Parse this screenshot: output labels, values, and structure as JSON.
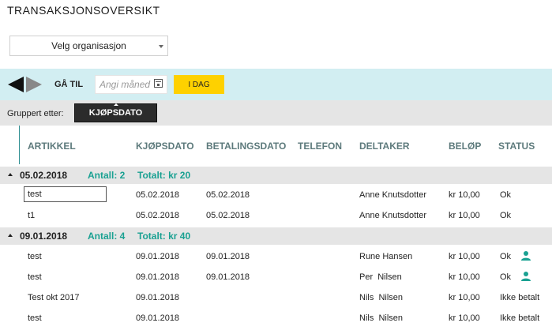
{
  "page": {
    "title": "TRANSAKSJONSOVERSIKT"
  },
  "org_select": {
    "value": "Velg organisasjon"
  },
  "nav": {
    "goto_label": "GÅ TIL",
    "month_placeholder": "Angi måned",
    "today_label": "I DAG"
  },
  "grouping": {
    "label": "Gruppert etter:",
    "chip_label": "KJØPSDATO"
  },
  "columns": {
    "artikkel": "ARTIKKEL",
    "kjopsdato": "KJØPSDATO",
    "betalingsdato": "BETALINGSDATO",
    "telefon": "TELEFON",
    "deltaker": "DELTAKER",
    "belop": "BELØP",
    "status": "STATUS"
  },
  "groups": [
    {
      "date": "05.02.2018",
      "count": "Antall: 2",
      "total": "Totalt: kr 20",
      "rows": [
        {
          "artikkel": "test",
          "kjopsdato": "05.02.2018",
          "betalingsdato": "05.02.2018",
          "telefon": "",
          "deltaker": "Anne Knutsdotter",
          "belop": "kr 10,00",
          "status": "Ok"
        },
        {
          "artikkel": "t1",
          "kjopsdato": "05.02.2018",
          "betalingsdato": "05.02.2018",
          "telefon": "",
          "deltaker": "Anne Knutsdotter",
          "belop": "kr 10,00",
          "status": "Ok"
        }
      ]
    },
    {
      "date": "09.01.2018",
      "count": "Antall: 4",
      "total": "Totalt: kr 40",
      "rows": [
        {
          "artikkel": "test",
          "kjopsdato": "09.01.2018",
          "betalingsdato": "09.01.2018",
          "telefon": "",
          "deltaker": "Rune Hansen",
          "belop": "kr 10,00",
          "status": "Ok",
          "icon": "person-icon"
        },
        {
          "artikkel": "test",
          "kjopsdato": "09.01.2018",
          "betalingsdato": "09.01.2018",
          "telefon": "",
          "deltaker": "Per  Nilsen",
          "belop": "kr 10,00",
          "status": "Ok",
          "icon": "person-icon"
        },
        {
          "artikkel": "Test okt 2017",
          "kjopsdato": "09.01.2018",
          "betalingsdato": "",
          "telefon": "",
          "deltaker": "Nils  Nilsen",
          "belop": "kr 10,00",
          "status": "Ikke betalt"
        },
        {
          "artikkel": "test",
          "kjopsdato": "09.01.2018",
          "betalingsdato": "",
          "telefon": "",
          "deltaker": "Nils  Nilsen",
          "belop": "kr 10,00",
          "status": "Ikke betalt"
        }
      ]
    }
  ],
  "colors": {
    "accent_teal": "#1aa192",
    "nav_bg": "#d2eef2",
    "today_yellow": "#fed100",
    "group_bg": "#e5e5e5"
  }
}
